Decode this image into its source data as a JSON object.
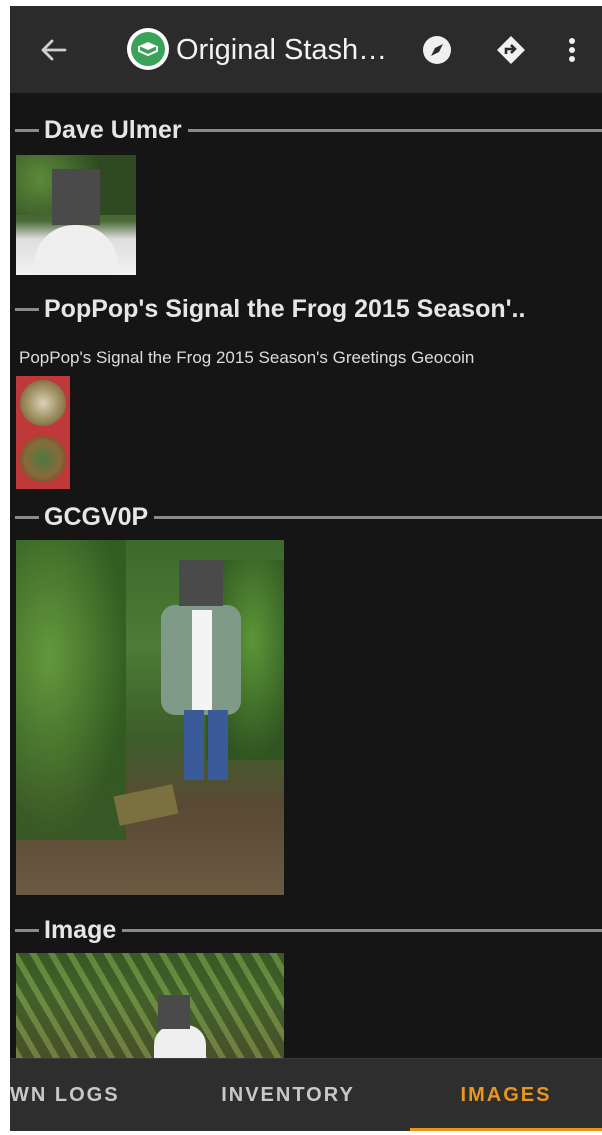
{
  "appbar": {
    "title": "Original Stash…",
    "icons": [
      "back-arrow-icon",
      "cache-logo-icon",
      "compass-icon",
      "navigate-icon",
      "more-vert-icon"
    ]
  },
  "sections": [
    {
      "title": "Dave Ulmer"
    },
    {
      "title": "PopPop's Signal the Frog 2015 Season'..",
      "description": "PopPop's Signal the Frog 2015 Season's Greetings Geocoin"
    },
    {
      "title": "GCGV0P"
    },
    {
      "title": "Image"
    }
  ],
  "tabs": [
    {
      "label": "WN LOGS"
    },
    {
      "label": "INVENTORY"
    },
    {
      "label": "IMAGES",
      "active": true
    }
  ],
  "colors": {
    "accent": "#e8961e",
    "background": "#151515",
    "appbar": "#2b2b2b"
  }
}
